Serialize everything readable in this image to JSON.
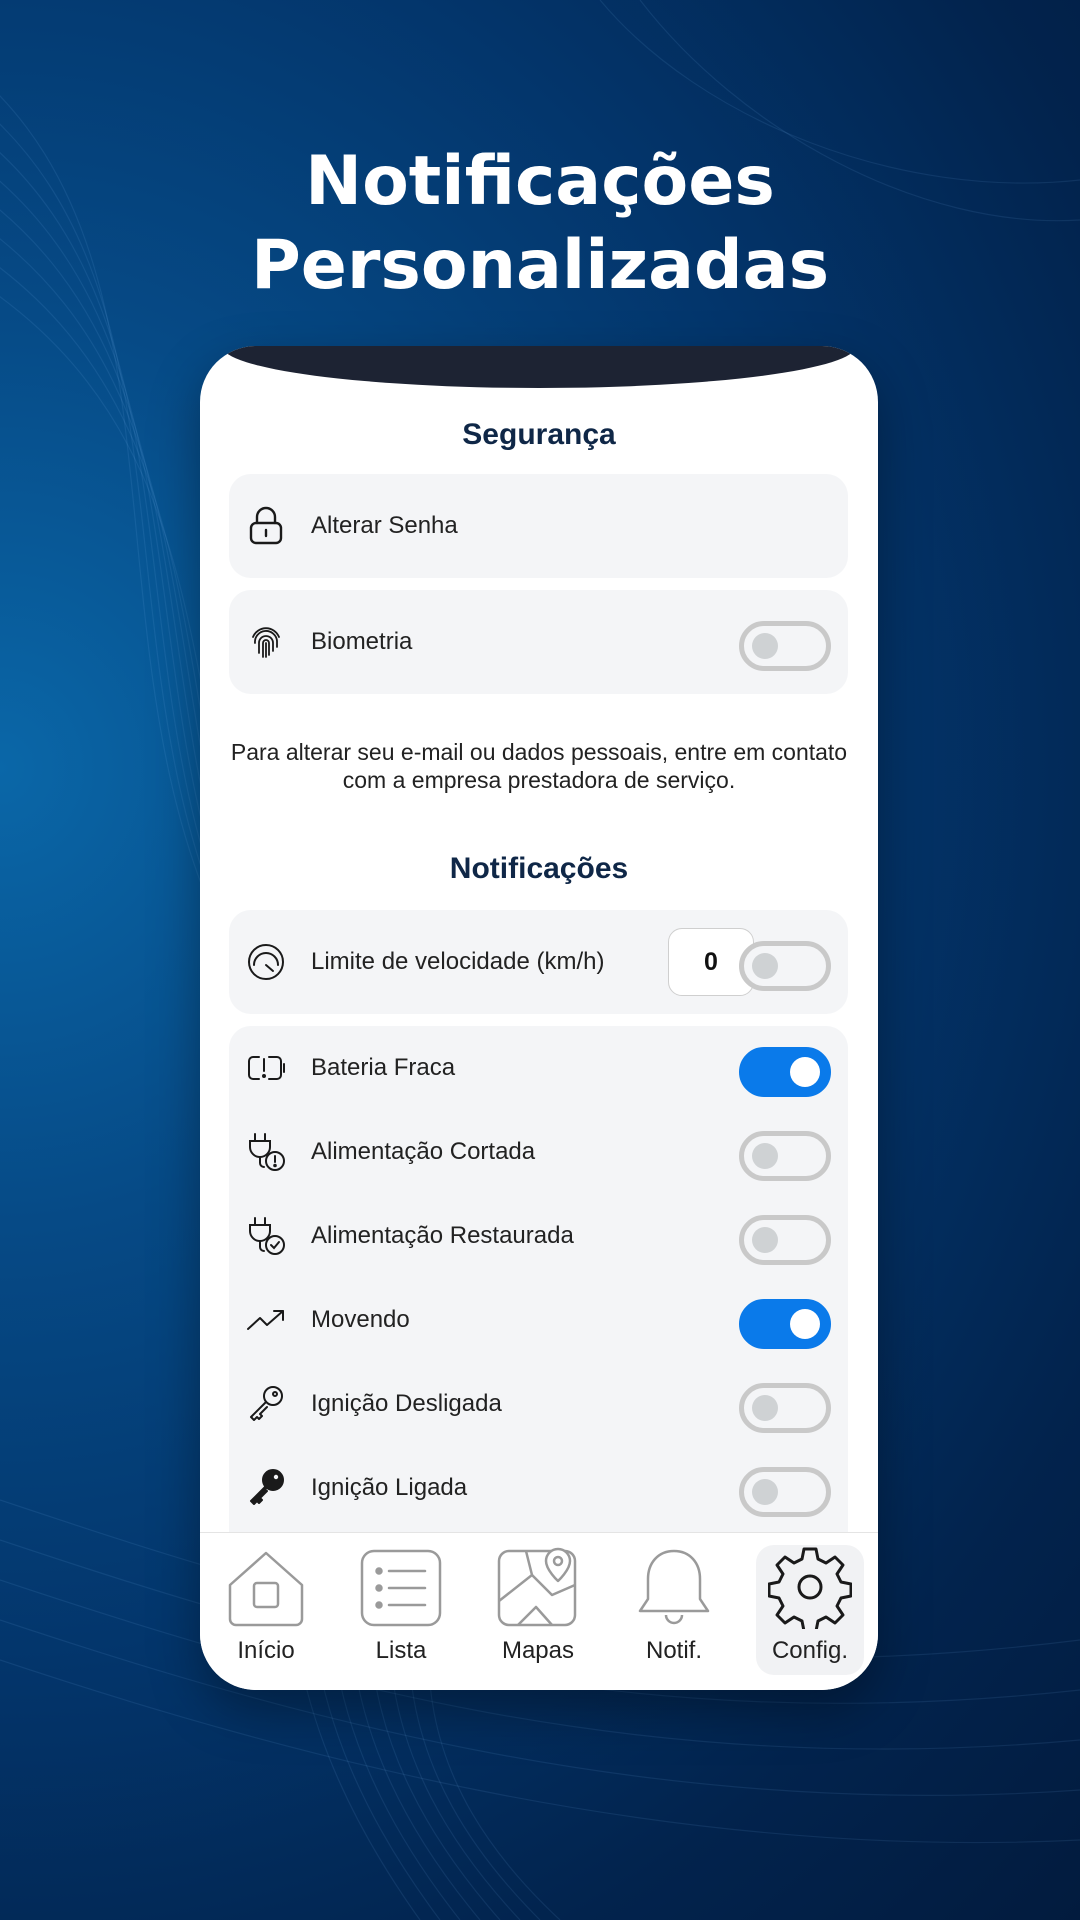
{
  "headline": {
    "line1": "Notificações",
    "line2": "Personalizadas"
  },
  "security": {
    "title": "Segurança",
    "change_password": {
      "label": "Alterar Senha",
      "icon": "lock-icon"
    },
    "biometrics": {
      "label": "Biometria",
      "icon": "fingerprint-icon",
      "enabled": false
    }
  },
  "note": "Para alterar seu e-mail ou dados pessoais, entre em contato com a empresa prestadora de serviço.",
  "notifications": {
    "title": "Notificações",
    "speed_limit": {
      "label": "Limite de velocidade (km/h)",
      "value": "0",
      "enabled": false,
      "icon": "speedometer-icon"
    },
    "items": [
      {
        "label": "Bateria Fraca",
        "icon": "low-battery-icon",
        "enabled": true
      },
      {
        "label": "Alimentação Cortada",
        "icon": "plug-alert-icon",
        "enabled": false
      },
      {
        "label": "Alimentação Restaurada",
        "icon": "plug-check-icon",
        "enabled": false
      },
      {
        "label": "Movendo",
        "icon": "trending-up-icon",
        "enabled": true
      },
      {
        "label": "Ignição Desligada",
        "icon": "key-outline-icon",
        "enabled": false
      },
      {
        "label": "Ignição Ligada",
        "icon": "key-filled-icon",
        "enabled": false
      }
    ]
  },
  "tabs": [
    {
      "label": "Início",
      "icon": "home-icon",
      "active": false
    },
    {
      "label": "Lista",
      "icon": "list-icon",
      "active": false
    },
    {
      "label": "Mapas",
      "icon": "map-pin-icon",
      "active": false
    },
    {
      "label": "Notif.",
      "icon": "bell-icon",
      "active": false
    },
    {
      "label": "Config.",
      "icon": "gear-icon",
      "active": true
    }
  ],
  "colors": {
    "accent": "#0a7aea",
    "title": "#0f2747",
    "background": "#03356b"
  }
}
